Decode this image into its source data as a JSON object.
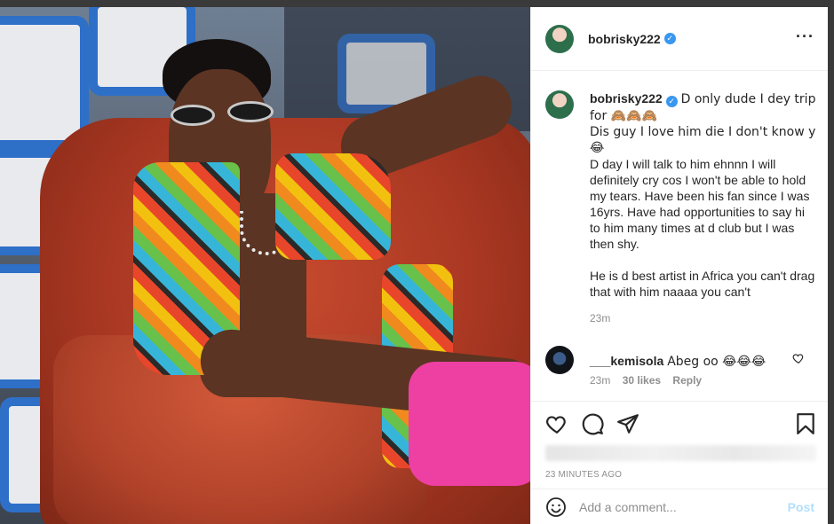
{
  "colors": {
    "accent": "#3897f0",
    "text": "#262626",
    "muted": "#8e8e8e",
    "post_disabled": "#b2dffc"
  },
  "header": {
    "username": "bobrisky222",
    "verified_icon": "verified-badge-icon",
    "more_icon": "more-horizontal-icon"
  },
  "caption": {
    "username": "bobrisky222",
    "line1": "D only dude I dey trip for 🙈🙈🙈",
    "line2": "Dis guy I love him die I don't know y 😂",
    "line3": "D day I will talk to him ehnnn I will definitely cry cos I won't be able to hold my tears. Have been his fan since I was 16yrs. Have had opportunities to say hi to him many times at d club but I was then shy.",
    "line4": "He is d best artist in Africa you can't drag that with him naaaa you can't",
    "time": "23m"
  },
  "comment": {
    "username": "___kemisola",
    "text": "Abeg oo 😂😂😂",
    "time": "23m",
    "likes": "30 likes",
    "reply": "Reply"
  },
  "actions": {
    "icons": [
      "heart-icon",
      "comment-icon",
      "share-icon",
      "bookmark-icon"
    ]
  },
  "posted_time": "23 MINUTES AGO",
  "add_comment": {
    "placeholder": "Add a comment...",
    "post_label": "Post"
  }
}
